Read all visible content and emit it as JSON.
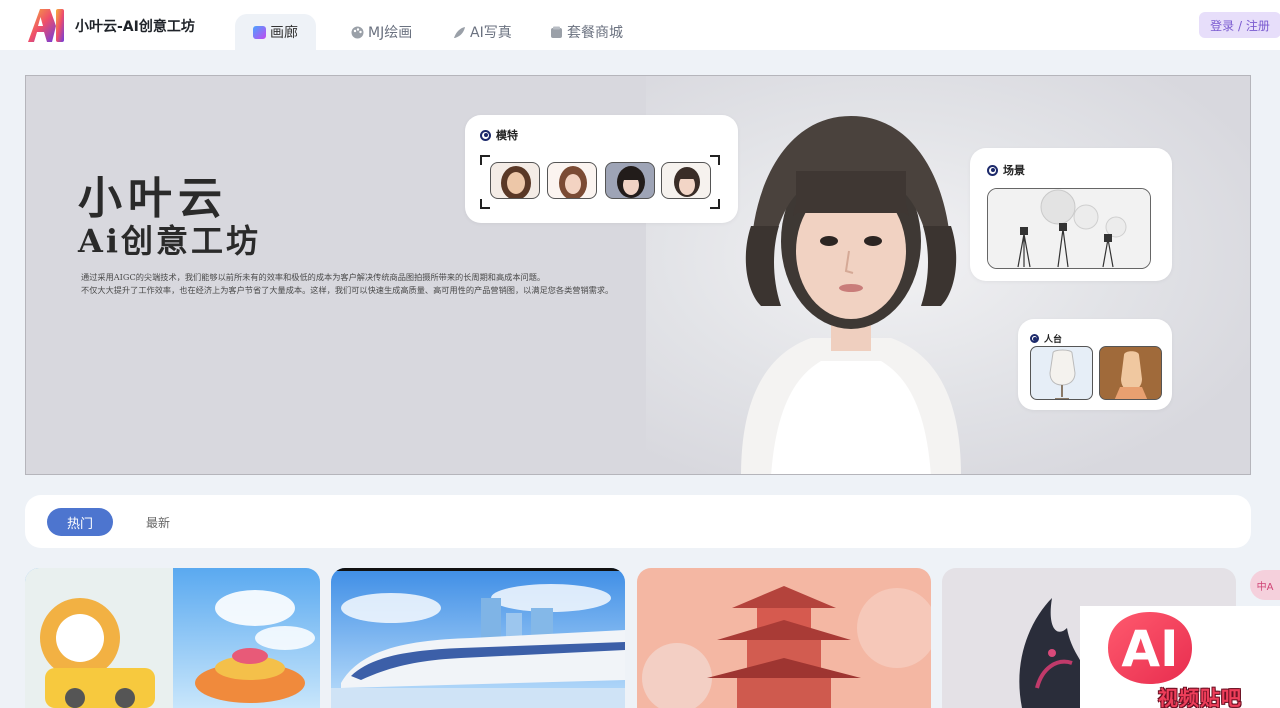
{
  "header": {
    "brand": "小叶云-AI创意工坊",
    "tabs": [
      {
        "label": "画廊",
        "icon": "gallery-icon",
        "active": true
      },
      {
        "label": "MJ绘画",
        "icon": "palette-icon",
        "active": false
      },
      {
        "label": "AI写真",
        "icon": "feather-icon",
        "active": false
      },
      {
        "label": "套餐商城",
        "icon": "store-icon",
        "active": false
      }
    ],
    "login": "登录 / 注册"
  },
  "hero": {
    "title": "小叶云",
    "subtitle": "Ai创意工坊",
    "desc_line1": "通过采用AIGC的尖端技术，我们能够以前所未有的效率和极低的成本为客户解决传统商品图拍摄所带来的长周期和高成本问题。",
    "desc_line2": "不仅大大提升了工作效率，也在经济上为客户节省了大量成本。这样，我们可以快速生成高质量、高可用性的产品营销图，以满足您各类营销需求。",
    "model_card": {
      "label": "模特"
    },
    "scene_card": {
      "label": "场景"
    },
    "mannequin_card": {
      "label": "人台"
    }
  },
  "filters": {
    "hot": "热门",
    "latest": "最新",
    "active": "热门"
  },
  "gallery": [
    {
      "theme": "3d-cartoon-train"
    },
    {
      "theme": "bullet-train-anime"
    },
    {
      "theme": "pink-pagoda"
    },
    {
      "theme": "dark-dragon-creature"
    }
  ],
  "translate": "中A",
  "watermark": {
    "logo": "AI",
    "text": "视频贴吧"
  },
  "colors": {
    "accent": "#4d75cf",
    "login_bg": "#e7defa",
    "login_text": "#7a5ad0",
    "page_bg": "#eef2f7"
  }
}
